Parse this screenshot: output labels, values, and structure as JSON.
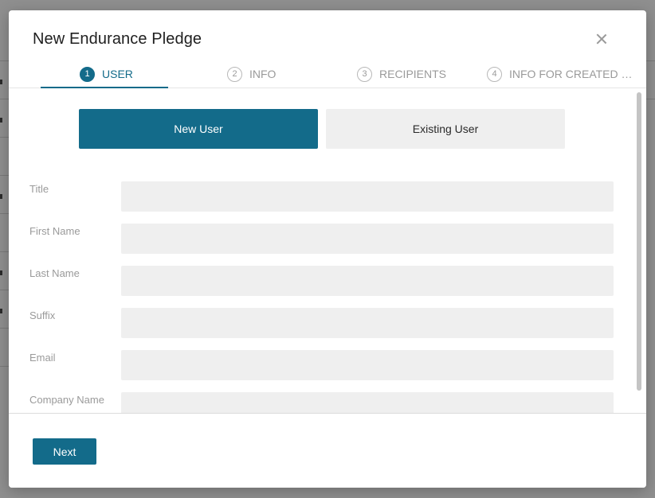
{
  "modal": {
    "title": "New Endurance Pledge",
    "close_icon": "close-icon"
  },
  "steps": [
    {
      "number": "1",
      "label": "USER",
      "active": true
    },
    {
      "number": "2",
      "label": "INFO",
      "active": false
    },
    {
      "number": "3",
      "label": "RECIPIENTS",
      "active": false
    },
    {
      "number": "4",
      "label": "INFO FOR CREATED D...",
      "active": false
    }
  ],
  "user_toggle": {
    "new_user_label": "New User",
    "existing_user_label": "Existing User",
    "selected": "New User"
  },
  "form": {
    "fields": [
      {
        "label": "Title",
        "value": ""
      },
      {
        "label": "First Name",
        "value": ""
      },
      {
        "label": "Last Name",
        "value": ""
      },
      {
        "label": "Suffix",
        "value": ""
      },
      {
        "label": "Email",
        "value": ""
      },
      {
        "label": "Company Name",
        "value": ""
      }
    ]
  },
  "footer": {
    "next_label": "Next"
  },
  "colors": {
    "accent": "#136b8a",
    "input_bg": "#efefef",
    "label": "#9a9a9a"
  }
}
